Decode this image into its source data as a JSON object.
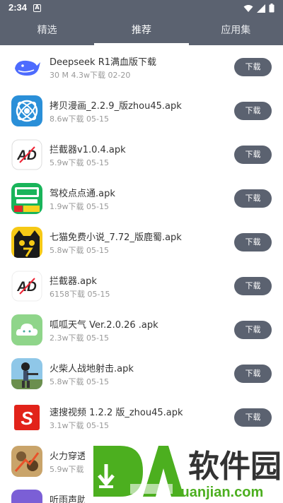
{
  "status": {
    "time": "2:34",
    "notif": "A"
  },
  "tabs": [
    {
      "label": "精选"
    },
    {
      "label": "推荐"
    },
    {
      "label": "应用集"
    }
  ],
  "active_tab": 1,
  "download_label": "下载",
  "apps": [
    {
      "name": "Deepseek R1满血版下载",
      "meta": "30 M  4.3w下载  02-20",
      "icon": "deepseek-whale-icon"
    },
    {
      "name": "拷贝漫画_2.2.9_版zhou45.apk",
      "meta": " 8.6w下载  05-15",
      "icon": "copymanga-icon"
    },
    {
      "name": "拦截器v1.0.4.apk",
      "meta": " 5.9w下载  05-15",
      "icon": "ad-blocker-icon"
    },
    {
      "name": "驾校点点通.apk",
      "meta": " 1.9w下载  05-15",
      "icon": "driving-school-icon"
    },
    {
      "name": "七猫免费小说_7.72_版鹿蜀.apk",
      "meta": " 5.8w下载  05-15",
      "icon": "qimao-cat-icon"
    },
    {
      "name": "拦截器.apk",
      "meta": " 6158下载  05-15",
      "icon": "ad-blocker-icon"
    },
    {
      "name": "呱呱天气 Ver.2.0.26  .apk",
      "meta": " 2.3w下载  05-15",
      "icon": "weather-cloud-icon"
    },
    {
      "name": "火柴人战地射击.apk",
      "meta": " 5.8w下载  05-15",
      "icon": "stickman-shooter-icon"
    },
    {
      "name": "速搜视频 1.2.2 版_zhou45.apk",
      "meta": " 3.1w下载  05-15",
      "icon": "susou-video-icon"
    },
    {
      "name": "火力穿透",
      "meta": " 5.9w下载",
      "icon": "firepower-game-icon"
    },
    {
      "name": "听雨声助",
      "meta": "",
      "icon": "tingyu-icon"
    }
  ],
  "watermark": {
    "text": "软件园",
    "domain": "ruanjian.com"
  },
  "colors": {
    "bar": "#5b6270",
    "button": "#5b6270",
    "text": "#333333",
    "meta": "#999999"
  }
}
